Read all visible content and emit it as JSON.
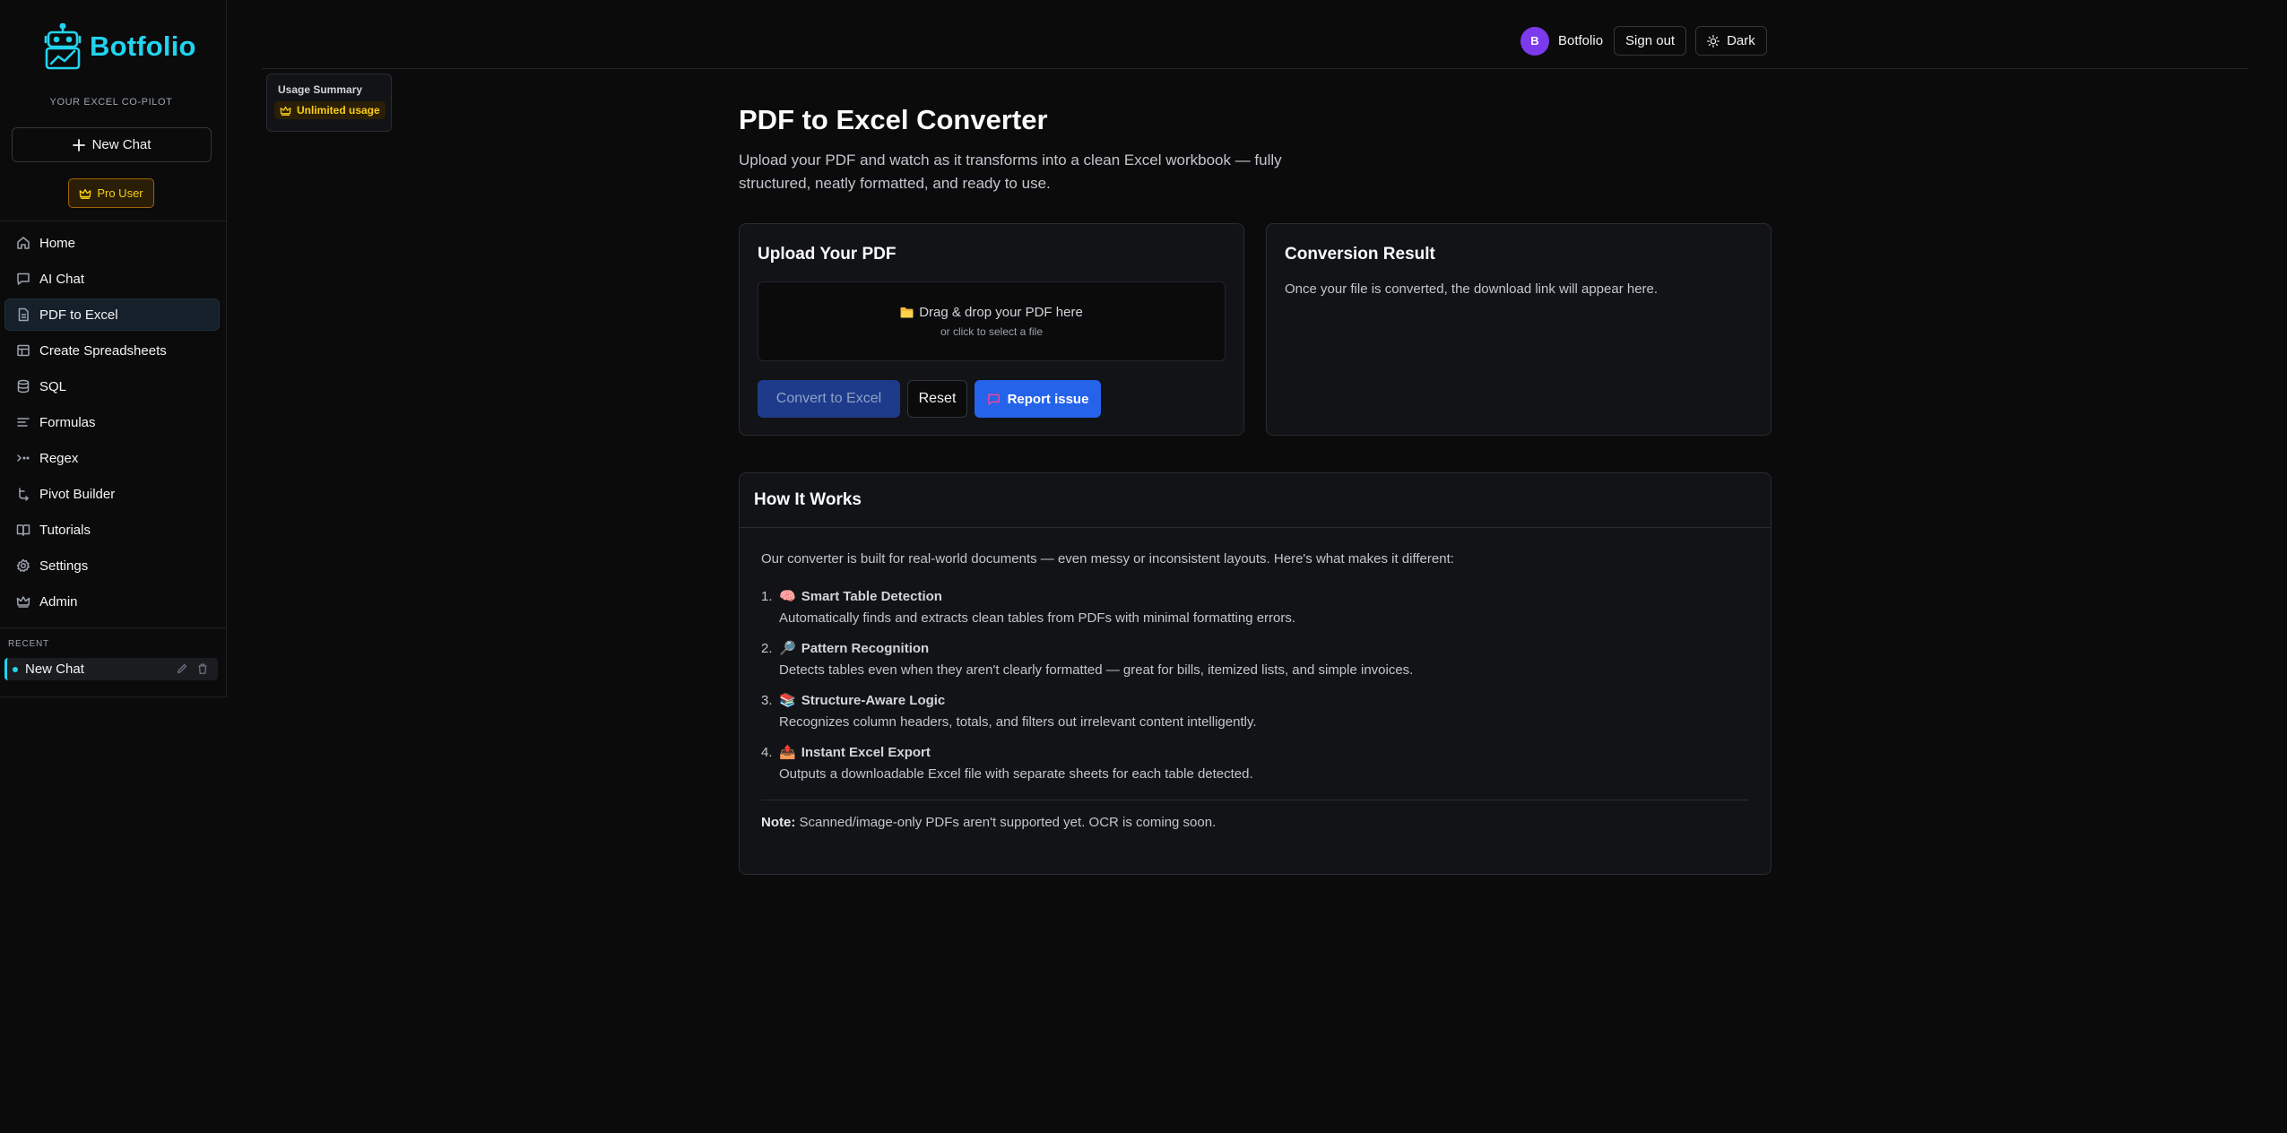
{
  "brand": {
    "name": "Botfolio",
    "tagline": "YOUR EXCEL CO-PILOT",
    "accent_color": "#22d3ee"
  },
  "sidebar": {
    "new_chat_label": "New Chat",
    "pro_badge_label": "Pro User",
    "items": [
      {
        "label": "Home",
        "icon": "home-icon"
      },
      {
        "label": "AI Chat",
        "icon": "chat-icon"
      },
      {
        "label": "PDF to Excel",
        "icon": "document-icon",
        "active": true
      },
      {
        "label": "Create Spreadsheets",
        "icon": "table-icon"
      },
      {
        "label": "SQL",
        "icon": "database-icon"
      },
      {
        "label": "Formulas",
        "icon": "formula-icon"
      },
      {
        "label": "Regex",
        "icon": "regex-icon"
      },
      {
        "label": "Pivot Builder",
        "icon": "pivot-icon"
      },
      {
        "label": "Tutorials",
        "icon": "book-icon"
      },
      {
        "label": "Settings",
        "icon": "gear-icon"
      },
      {
        "label": "Admin",
        "icon": "crown-icon"
      }
    ],
    "recent_label": "RECENT",
    "recent_items": [
      {
        "label": "New Chat"
      }
    ]
  },
  "header": {
    "avatar_initial": "B",
    "user_name": "Botfolio",
    "sign_out_label": "Sign out",
    "theme_label": "Dark"
  },
  "usage": {
    "title": "Usage Summary",
    "status": "Unlimited usage"
  },
  "main": {
    "title": "PDF to Excel Converter",
    "subtitle": "Upload your PDF and watch as it transforms into a clean Excel workbook — fully structured, neatly formatted, and ready to use.",
    "upload": {
      "title": "Upload Your PDF",
      "drop_main": "Drag & drop your PDF here",
      "drop_sub": "or click to select a file",
      "convert_label": "Convert to Excel",
      "reset_label": "Reset",
      "report_label": "Report issue"
    },
    "result": {
      "title": "Conversion Result",
      "placeholder": "Once your file is converted, the download link will appear here."
    },
    "how": {
      "title": "How It Works",
      "intro": "Our converter is built for real-world documents — even messy or inconsistent layouts. Here's what makes it different:",
      "steps": [
        {
          "num": "1.",
          "emoji": "🧠",
          "title": "Smart Table Detection",
          "desc": "Automatically finds and extracts clean tables from PDFs with minimal formatting errors."
        },
        {
          "num": "2.",
          "emoji": "🔎",
          "title": "Pattern Recognition",
          "desc": "Detects tables even when they aren't clearly formatted — great for bills, itemized lists, and simple invoices."
        },
        {
          "num": "3.",
          "emoji": "📚",
          "title": "Structure-Aware Logic",
          "desc": "Recognizes column headers, totals, and filters out irrelevant content intelligently."
        },
        {
          "num": "4.",
          "emoji": "📤",
          "title": "Instant Excel Export",
          "desc": "Outputs a downloadable Excel file with separate sheets for each table detected."
        }
      ],
      "note_label": "Note:",
      "note_text": " Scanned/image-only PDFs aren't supported yet. OCR is coming soon."
    }
  }
}
